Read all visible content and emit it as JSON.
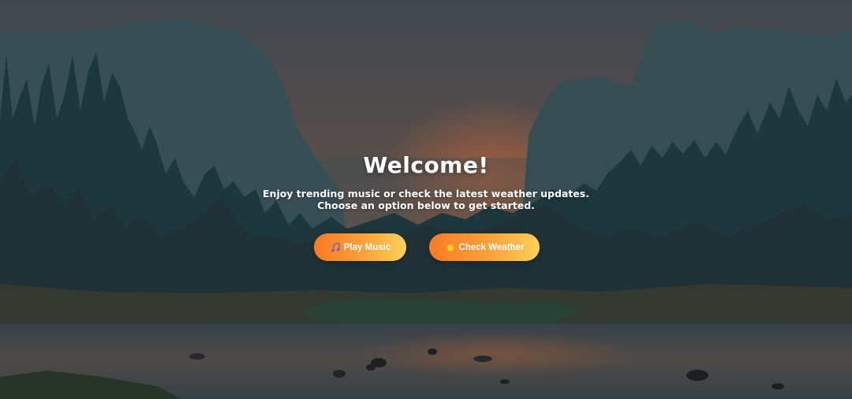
{
  "page": {
    "title": "Welcome!",
    "subtitle_lines": [
      "Enjoy trending music or check the latest weather updates.",
      "Choose an option below to get started."
    ]
  },
  "actions": {
    "play_music": {
      "label": "Play Music",
      "icon": "music-note-icon"
    },
    "check_weather": {
      "label": "Check Weather",
      "icon": "sun-icon"
    }
  },
  "colors": {
    "button_gradient_start": "#f97a25",
    "button_gradient_end": "#fcd15a",
    "text": "#ffffff",
    "sky_glow": "#c0704e"
  }
}
